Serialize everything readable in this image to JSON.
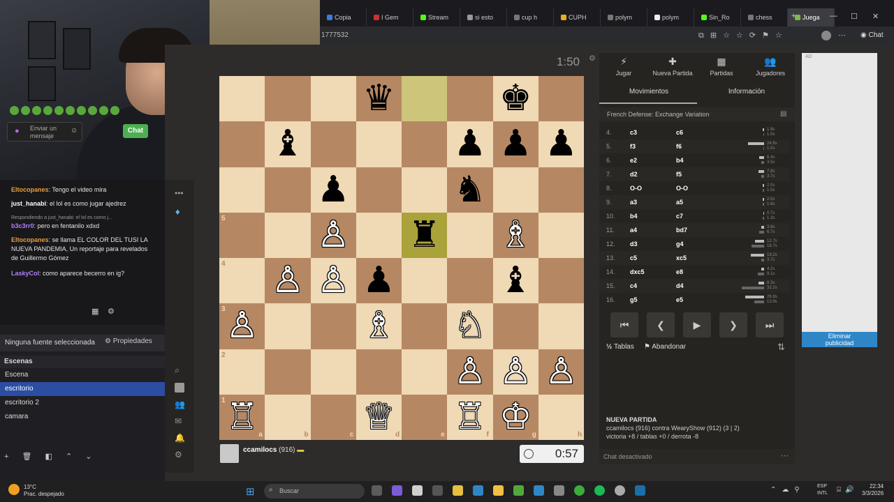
{
  "browser": {
    "tabs": [
      {
        "label": "Copia",
        "color": "#3b7de0"
      },
      {
        "label": "I Gem",
        "color": "#d03030"
      },
      {
        "label": "Stream",
        "color": "#53fc18"
      },
      {
        "label": "si esto",
        "color": "#999999"
      },
      {
        "label": "cup h",
        "color": "#777777"
      },
      {
        "label": "CUPH",
        "color": "#e8b020"
      },
      {
        "label": "polym",
        "color": "#777777"
      },
      {
        "label": "polym",
        "color": "#eeeeee"
      },
      {
        "label": "Sin_Ro",
        "color": "#53fc18"
      },
      {
        "label": "chess",
        "color": "#777777"
      },
      {
        "label": "Juega",
        "color": "#81b64c"
      }
    ],
    "url": "1777532",
    "chat_label": "Chat"
  },
  "stream_chat": {
    "lines": [
      {
        "user": "Eltocopanes",
        "user_color": "#e8a040",
        "text": ": Tengo el video mira"
      },
      {
        "user": "just_hanabi",
        "user_color": "#ffffff",
        "text": ": el lol es como jugar ajedrez"
      },
      {
        "user": "",
        "user_color": "#999",
        "text": "Respondiendo a just_hanabi: el lol es como j..."
      },
      {
        "user": "b3c3rr0",
        "user_color": "#b080ff",
        "text": ": pero en fentanilo xdxd"
      },
      {
        "user": "Eltocopanes",
        "user_color": "#e8a040",
        "text": ": se llama EL COLOR DEL TUSI LA NUEVA PANDEMIA, Un reportaje para revelados de Guillermo Gómez"
      },
      {
        "user": "LaskyCol",
        "user_color": "#b080ff",
        "text": ": como aparece becerro en ig?"
      }
    ],
    "input_placeholder": "Enviar un mensaje",
    "send_label": "Chat"
  },
  "obs": {
    "source_status": "Ninguna fuente seleccionada",
    "properties_label": "Propiedades",
    "scenes_title": "Escenas",
    "scenes": [
      {
        "label": "Escena",
        "active": false
      },
      {
        "label": "escritorio",
        "active": true
      },
      {
        "label": "escritorio 2",
        "active": false
      },
      {
        "label": "camara",
        "active": false
      }
    ]
  },
  "game": {
    "clock_top": "1:50",
    "clock_bottom": "0:57",
    "player_name": "ccamilocs",
    "player_rating": "(916)",
    "files": [
      "a",
      "b",
      "c",
      "d",
      "e",
      "f",
      "g",
      "h"
    ],
    "ranks": [
      "5",
      "4",
      "3",
      "2",
      "1"
    ],
    "pieces": [
      {
        "sq": "d8",
        "p": "♛",
        "c": "b"
      },
      {
        "sq": "g8",
        "p": "♚",
        "c": "b"
      },
      {
        "sq": "b7",
        "p": "♝",
        "c": "b"
      },
      {
        "sq": "f7",
        "p": "♟",
        "c": "b"
      },
      {
        "sq": "g7",
        "p": "♟",
        "c": "b"
      },
      {
        "sq": "h7",
        "p": "♟",
        "c": "b"
      },
      {
        "sq": "c6",
        "p": "♟",
        "c": "b"
      },
      {
        "sq": "f6",
        "p": "♞",
        "c": "b"
      },
      {
        "sq": "c5",
        "p": "♙",
        "c": "w"
      },
      {
        "sq": "e5",
        "p": "♜",
        "c": "b"
      },
      {
        "sq": "g5",
        "p": "♗",
        "c": "w"
      },
      {
        "sq": "b4",
        "p": "♙",
        "c": "w"
      },
      {
        "sq": "c4",
        "p": "♙",
        "c": "w"
      },
      {
        "sq": "d4",
        "p": "♟",
        "c": "b"
      },
      {
        "sq": "g4",
        "p": "♝",
        "c": "b"
      },
      {
        "sq": "a3",
        "p": "♙",
        "c": "w"
      },
      {
        "sq": "d3",
        "p": "♗",
        "c": "w"
      },
      {
        "sq": "f3",
        "p": "♘",
        "c": "w"
      },
      {
        "sq": "f2",
        "p": "♙",
        "c": "w"
      },
      {
        "sq": "g2",
        "p": "♙",
        "c": "w"
      },
      {
        "sq": "h2",
        "p": "♙",
        "c": "w"
      },
      {
        "sq": "a1",
        "p": "♖",
        "c": "w"
      },
      {
        "sq": "d1",
        "p": "♕",
        "c": "w"
      },
      {
        "sq": "f1",
        "p": "♖",
        "c": "w"
      },
      {
        "sq": "g1",
        "p": "♔",
        "c": "w"
      }
    ],
    "highlight": [
      "e8",
      "e5"
    ]
  },
  "side": {
    "nav": [
      {
        "label": "Jugar",
        "icon": "⚡"
      },
      {
        "label": "Nueva Partida",
        "icon": "✚"
      },
      {
        "label": "Partidas",
        "icon": "▦"
      },
      {
        "label": "Jugadores",
        "icon": "👥"
      }
    ],
    "tab_moves": "Movimientos",
    "tab_info": "Información",
    "opening": "French Defense: Exchange Variation",
    "moves": [
      {
        "n": "4.",
        "w": "c3",
        "b": "c6",
        "t1": "1.9s",
        "t2": "1.0s",
        "f1": 0.05,
        "f2": 0.03
      },
      {
        "n": "5.",
        "w": "f3",
        "b": "f6",
        "t1": "24.6s",
        "t2": "1.0s",
        "f1": 0.6,
        "f2": 0.03
      },
      {
        "n": "6.",
        "w": "e2",
        "b": "b4",
        "t1": "6.4s",
        "t2": "3.5s",
        "f1": 0.18,
        "f2": 0.1
      },
      {
        "n": "7.",
        "w": "d2",
        "b": "f5",
        "t1": "7.8s",
        "t2": "3.7s",
        "f1": 0.2,
        "f2": 0.1
      },
      {
        "n": "8.",
        "w": "O-O",
        "b": "O-O",
        "t1": "2.0s",
        "t2": "1.5s",
        "f1": 0.06,
        "f2": 0.04
      },
      {
        "n": "9.",
        "w": "a3",
        "b": "a5",
        "t1": "2.0s",
        "t2": "1.6s",
        "f1": 0.06,
        "f2": 0.05
      },
      {
        "n": "10.",
        "w": "b4",
        "b": "c7",
        "t1": "0.7s",
        "t2": "1.3s",
        "f1": 0.03,
        "f2": 0.04
      },
      {
        "n": "11.",
        "w": "a4",
        "b": "bd7",
        "t1": "3.8s",
        "t2": "6.7s",
        "f1": 0.1,
        "f2": 0.18
      },
      {
        "n": "12.",
        "w": "d3",
        "b": "g4",
        "t1": "12.7s",
        "t2": "18.7s",
        "f1": 0.33,
        "f2": 0.48
      },
      {
        "n": "13.",
        "w": "c5",
        "b": "xc5",
        "t1": "19.2s",
        "t2": "3.7s",
        "f1": 0.5,
        "f2": 0.1
      },
      {
        "n": "14.",
        "w": "dxc5",
        "b": "e8",
        "t1": "4.2s",
        "t2": "9.1s",
        "f1": 0.11,
        "f2": 0.24
      },
      {
        "n": "15.",
        "w": "c4",
        "b": "d4",
        "t1": "8.3s",
        "t2": "32.2s",
        "f1": 0.22,
        "f2": 0.84
      },
      {
        "n": "16.",
        "w": "g5",
        "b": "e5",
        "t1": "26.9s",
        "t2": "13.9s",
        "f1": 0.7,
        "f2": 0.36
      }
    ],
    "draw_label": "Tablas",
    "resign_label": "Abandonar",
    "new_game_title": "NUEVA PARTIDA",
    "new_game_line": "ccamilocs (916) contra WearyShow (912) (3 | 2)",
    "new_game_stats": "victoria +8 / tablas +0 / derrota -8",
    "chat_disabled": "Chat desactivado"
  },
  "ad": {
    "label": "AD",
    "remove": "Eliminar publicidad"
  },
  "taskbar": {
    "temp": "13°C",
    "weather": "Prac. despejado",
    "search": "Buscar",
    "lang1": "ESP",
    "lang2": "INTL",
    "time": "22:34",
    "date": "3/3/2026"
  }
}
